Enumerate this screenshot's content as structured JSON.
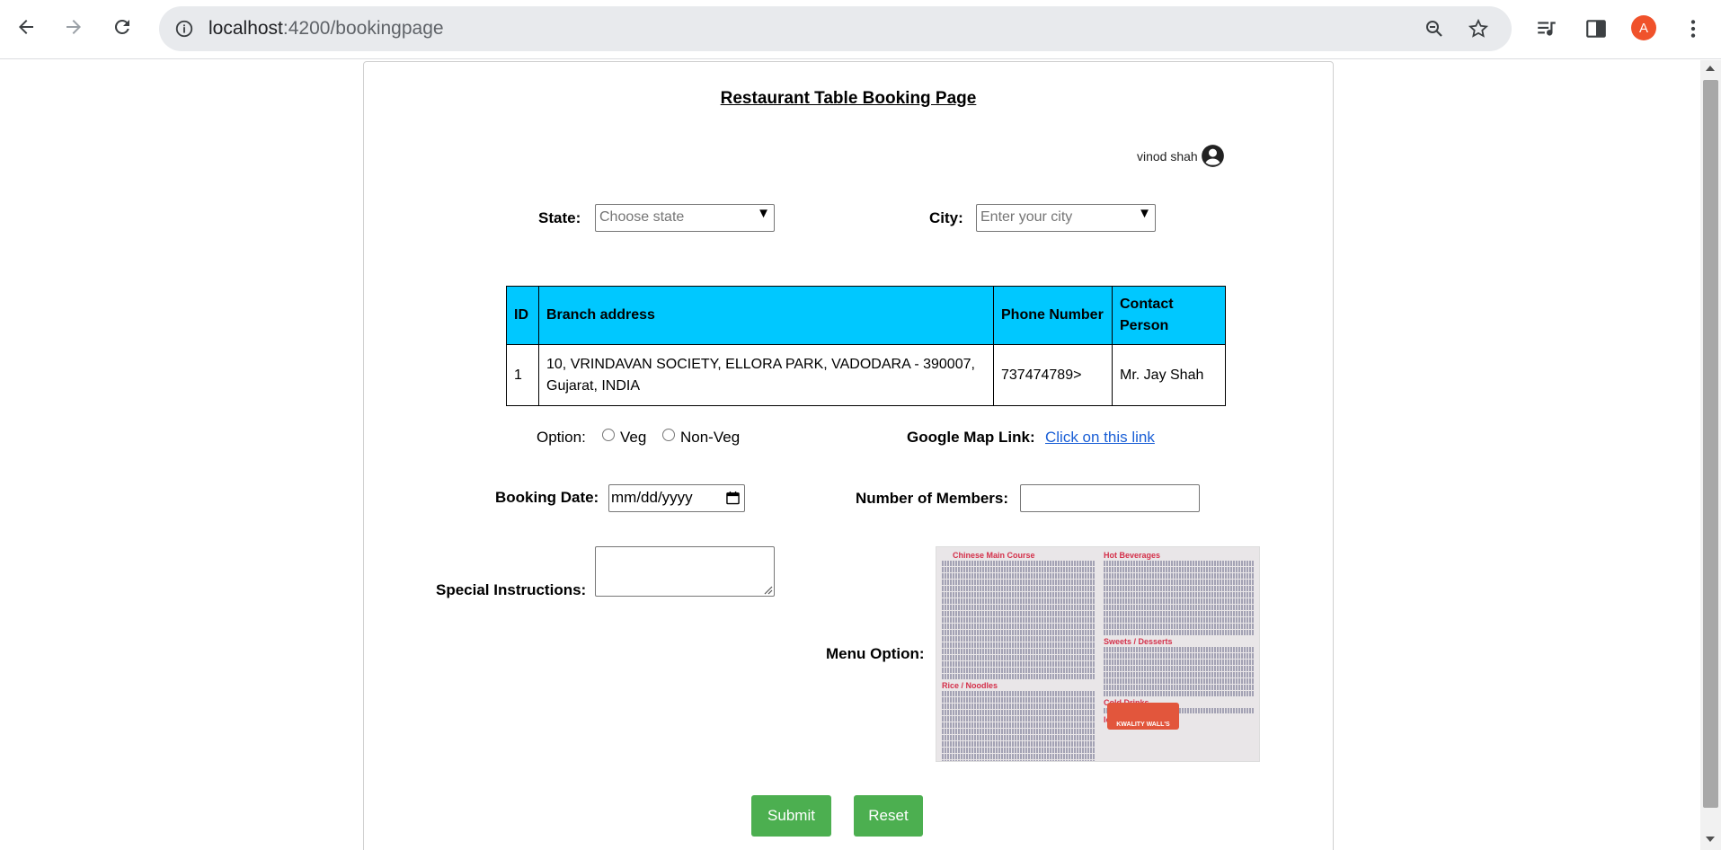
{
  "browser": {
    "url_host": "localhost",
    "url_path": ":4200/bookingpage",
    "profile_initial": "A"
  },
  "page": {
    "title": "Restaurant Table Booking Page",
    "user_name": "vinod shah"
  },
  "filters": {
    "state_label": "State:",
    "state_placeholder": "Choose state",
    "city_label": "City:",
    "city_placeholder": "Enter your city"
  },
  "table": {
    "headers": [
      "ID",
      "Branch address",
      "Phone Number",
      "Contact Person"
    ],
    "rows": [
      {
        "id": "1",
        "address": "10, VRINDAVAN SOCIETY, ELLORA PARK, VADODARA - 390007, Gujarat, INDIA",
        "phone": "737474789>",
        "contact": "Mr. Jay Shah"
      }
    ]
  },
  "options": {
    "label": "Option:",
    "veg": "Veg",
    "nonveg": "Non-Veg"
  },
  "map": {
    "label": "Google Map Link:",
    "link_text": "Click on this link"
  },
  "booking": {
    "date_label": "Booking Date:",
    "date_placeholder": "mm/dd/yyyy",
    "members_label": "Number of Members:",
    "instructions_label": "Special Instructions:",
    "menu_label": "Menu Option:"
  },
  "menu_image": {
    "sections": [
      "Chinese Main Course",
      "Hot Beverages",
      "Sweets / Desserts",
      "Rice / Noodles",
      "Cold Drinks",
      "Ice Creams"
    ],
    "logo_text": "KWALITY WALL'S"
  },
  "buttons": {
    "submit": "Submit",
    "reset": "Reset"
  },
  "colors": {
    "table_header": "#00c8ff",
    "button_bg": "#4caf50",
    "link": "#1a5fd6"
  }
}
